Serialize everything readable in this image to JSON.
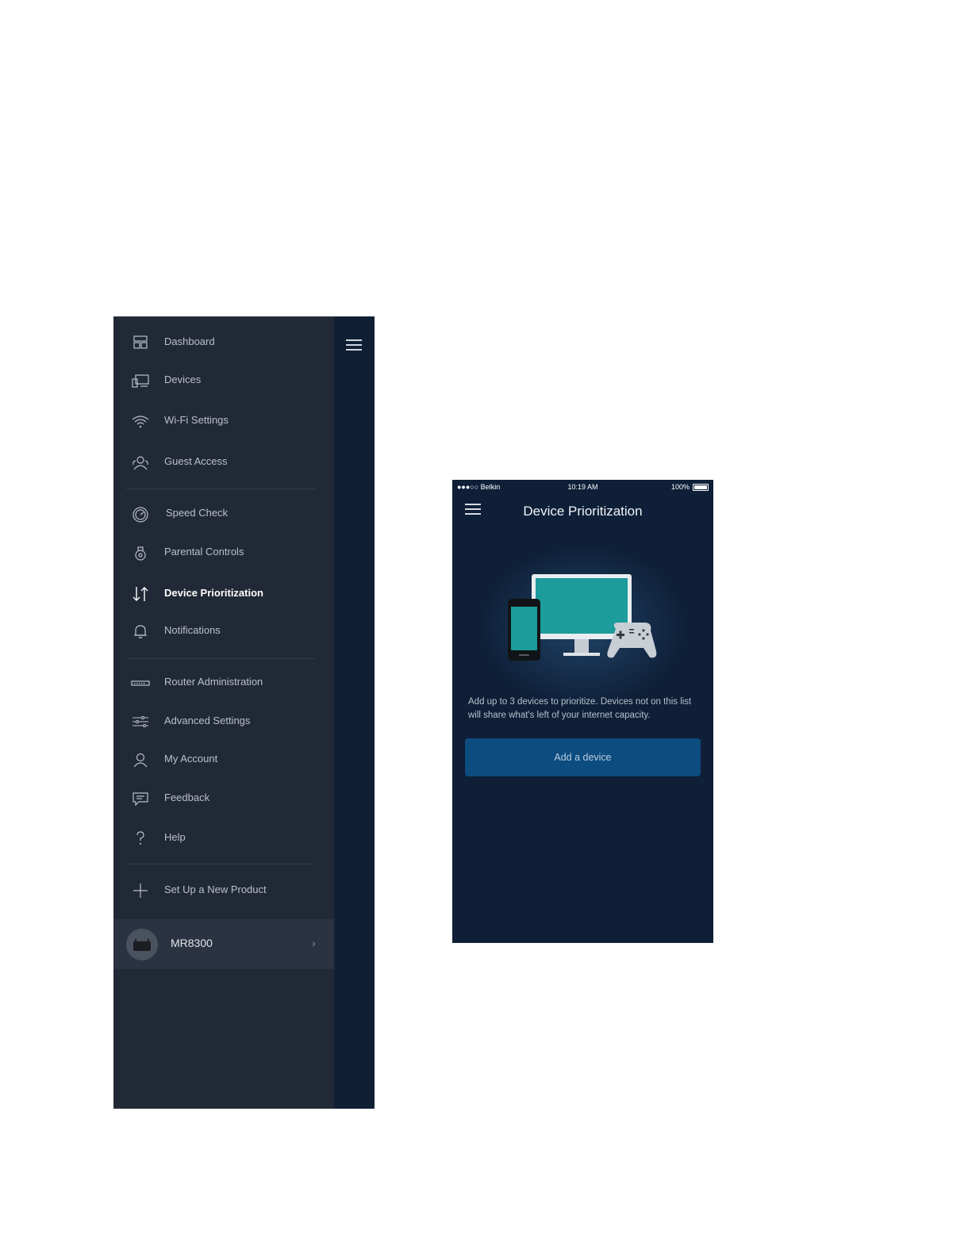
{
  "drawer": {
    "items": [
      {
        "label": "Dashboard",
        "icon": "dashboard-icon"
      },
      {
        "label": "Devices",
        "icon": "devices-icon"
      },
      {
        "label": "Wi-Fi Settings",
        "icon": "wifi-icon"
      },
      {
        "label": "Guest Access",
        "icon": "guest-access-icon"
      },
      {
        "label": "Speed Check",
        "icon": "speedometer-icon"
      },
      {
        "label": "Parental Controls",
        "icon": "parental-controls-icon"
      },
      {
        "label": "Device Prioritization",
        "icon": "prioritization-arrows-icon",
        "active": true
      },
      {
        "label": "Notifications",
        "icon": "bell-icon"
      },
      {
        "label": "Router Administration",
        "icon": "router-icon"
      },
      {
        "label": "Advanced Settings",
        "icon": "sliders-icon"
      },
      {
        "label": "My Account",
        "icon": "user-icon"
      },
      {
        "label": "Feedback",
        "icon": "chat-bubble-icon"
      },
      {
        "label": "Help",
        "icon": "question-mark-icon"
      },
      {
        "label": "Set Up a New Product",
        "icon": "plus-icon"
      }
    ],
    "product": {
      "name": "MR8300",
      "chevron": "›"
    }
  },
  "phone": {
    "status": {
      "carrier": "●●●○○ Belkin",
      "time": "10:19 AM",
      "battery": "100%"
    },
    "title": "Device Prioritization",
    "description": "Add up to 3 devices to prioritize. Devices not on this list will share what's left of your internet capacity.",
    "add_button_label": "Add a device"
  },
  "colors": {
    "drawer_bg": "#222936",
    "drawer_strip": "#0f2035",
    "phone_bg": "#0e1f37",
    "button_bg": "#0d4c7f",
    "monitor_screen": "#1c9c9a"
  }
}
